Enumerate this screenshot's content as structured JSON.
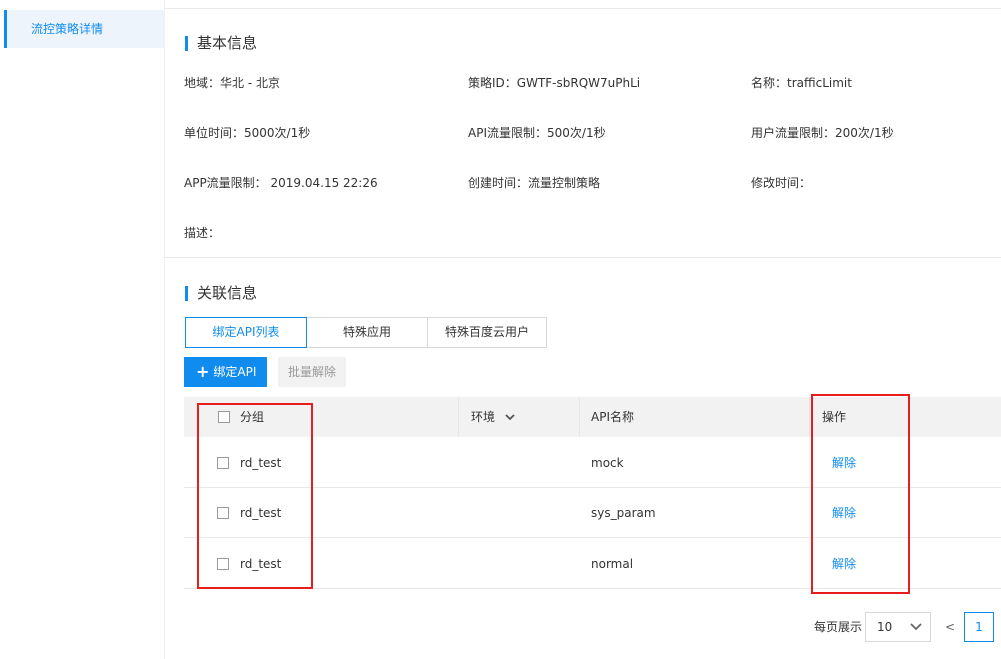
{
  "sidebar": {
    "items": [
      {
        "label": "流控策略详情"
      }
    ]
  },
  "basic": {
    "title": "基本信息",
    "fields": [
      {
        "label": "地域：",
        "value": "华北 - 北京"
      },
      {
        "label": "策略ID：",
        "value": "GWTF-sbRQW7uPhLi"
      },
      {
        "label": "名称：",
        "value": "trafficLimit"
      },
      {
        "label": "单位时间：",
        "value": "5000次/1秒"
      },
      {
        "label": "API流量限制：",
        "value": "500次/1秒"
      },
      {
        "label": "用户流量限制：",
        "value": "200次/1秒"
      },
      {
        "label": "APP流量限制：",
        "value": " 2019.04.15 22:26"
      },
      {
        "label": "创建时间：",
        "value": "流量控制策略"
      },
      {
        "label": "修改时间：",
        "value": ""
      },
      {
        "label": "描述：",
        "value": ""
      }
    ]
  },
  "related": {
    "title": "关联信息",
    "tabs": [
      {
        "label": "绑定API列表"
      },
      {
        "label": "特殊应用"
      },
      {
        "label": "特殊百度云用户"
      }
    ],
    "bind_button": "绑定API",
    "batch_button": "批量解除",
    "columns": {
      "group": "分组",
      "env": "环境",
      "api_name": "API名称",
      "action": "操作"
    },
    "rows": [
      {
        "group": "rd_test",
        "api_name": "mock",
        "action": "解除"
      },
      {
        "group": "rd_test",
        "api_name": "sys_param",
        "action": "解除"
      },
      {
        "group": "rd_test",
        "api_name": "normal",
        "action": "解除"
      }
    ]
  },
  "pagination": {
    "per_page_label": "每页展示",
    "per_page": "10",
    "prev": "<",
    "current": "1"
  },
  "colors": {
    "accent": "#108cee",
    "highlight": "#e81d1d"
  },
  "icons": [
    "plus-icon",
    "chevron-down-icon",
    "checkbox-icon"
  ]
}
